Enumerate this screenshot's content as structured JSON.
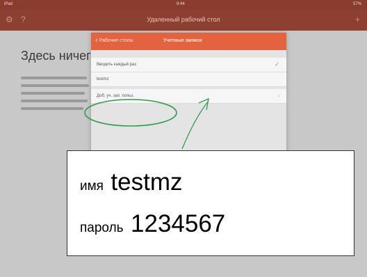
{
  "status_bar": {
    "left": "iPad",
    "time": "9:44",
    "right": "57%"
  },
  "app_header": {
    "title": "Удаленный рабочий стол"
  },
  "background": {
    "heading": "Здесь ничег",
    "paragraph_lines": 6
  },
  "modal": {
    "back_label": "Рабочие столы",
    "title": "Учетные записи",
    "rows": [
      {
        "label": "Вводить каждый раз",
        "checked": true
      },
      {
        "label": "testmz",
        "checked": false
      },
      {
        "label": "Доб. уч. зап. польз.",
        "checked": false
      }
    ]
  },
  "overlay": {
    "name_label": "имя",
    "name_value": "testmz",
    "password_label": "пароль",
    "password_value": "1234567"
  }
}
